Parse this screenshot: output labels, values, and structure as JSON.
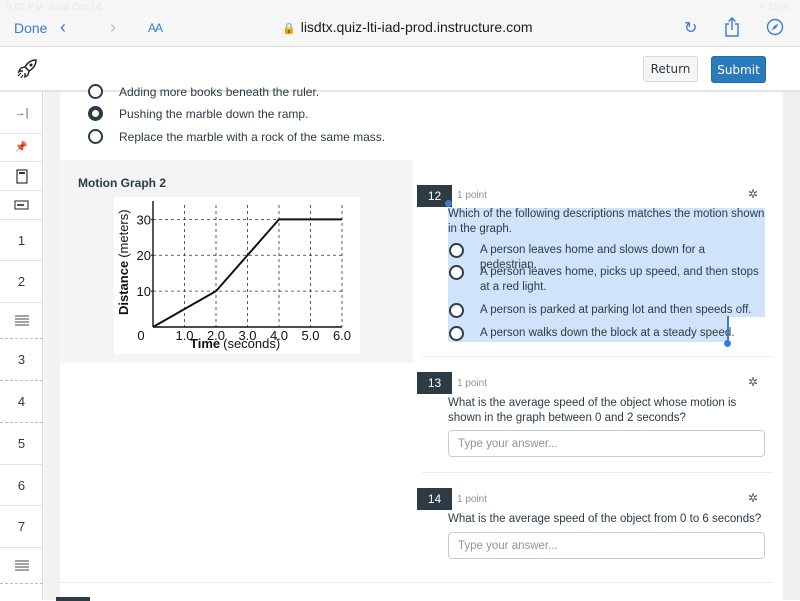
{
  "status_bar": {
    "time": "9:02 PM",
    "date": "Wed Oct 14",
    "battery": "15%"
  },
  "browser": {
    "done_label": "Done",
    "aa_label": "AA",
    "url": "lisdtx.quiz-lti-iad-prod.instructure.com"
  },
  "header": {
    "return_label": "Return",
    "submit_label": "Submit",
    "accent_color": "#2b7abc"
  },
  "rail": {
    "items": [
      {
        "type": "icon",
        "icon": "collapse-icon",
        "glyph": "→|"
      },
      {
        "type": "icon",
        "icon": "pin-icon",
        "glyph": "📌"
      },
      {
        "type": "icon",
        "icon": "page-icon"
      },
      {
        "type": "icon",
        "icon": "stimulus-icon"
      },
      {
        "type": "number",
        "label": "1"
      },
      {
        "type": "number",
        "label": "2"
      },
      {
        "type": "icon",
        "icon": "lines-icon"
      },
      {
        "type": "number",
        "label": "3"
      },
      {
        "type": "number",
        "label": "4"
      },
      {
        "type": "number",
        "label": "5"
      },
      {
        "type": "number",
        "label": "6"
      },
      {
        "type": "number",
        "label": "7"
      },
      {
        "type": "icon",
        "icon": "lines-icon"
      }
    ]
  },
  "previous_question": {
    "options": [
      {
        "label": "Adding more books beneath the ruler.",
        "selected": false
      },
      {
        "label": "Pushing the marble down the ramp.",
        "selected": true
      },
      {
        "label": "Replace the marble with a rock of the same mass.",
        "selected": false
      }
    ]
  },
  "stimulus": {
    "title": "Motion Graph 2"
  },
  "chart_data": {
    "type": "line",
    "title": "",
    "xlabel": "Time (seconds)",
    "xlabel_bold": "Time",
    "xlabel_unit": "(seconds)",
    "ylabel": "Distance (meters)",
    "ylabel_bold": "Distance",
    "ylabel_unit": "(meters)",
    "x": [
      0,
      2.0,
      3.0,
      4.0,
      6.0
    ],
    "series": [
      {
        "name": "distance",
        "values": [
          0,
          10,
          20,
          30,
          30
        ]
      }
    ],
    "xlim": [
      0,
      6
    ],
    "ylim": [
      0,
      34
    ],
    "xticks": [
      "0",
      "1.0",
      "2.0",
      "3.0",
      "4.0",
      "5.0",
      "6.0"
    ],
    "yticks": [
      "10",
      "20",
      "30"
    ],
    "grid": true
  },
  "questions": [
    {
      "number": "12",
      "points": "1 point",
      "text": "Which of the following descriptions matches the motion shown in the graph.",
      "options": [
        {
          "label": "A person leaves home and slows down for a pedestrian.",
          "selected": false
        },
        {
          "label": "A person leaves home, picks up speed, and then stops at a red light.",
          "selected": false
        },
        {
          "label": "A person is parked at parking lot and then speeds off.",
          "selected": false
        },
        {
          "label": "A person walks down the block at a steady speed.",
          "selected": false
        }
      ]
    },
    {
      "number": "13",
      "points": "1 point",
      "text": "What is the average speed of the object whose motion is shown in the graph between 0 and 2 seconds?",
      "answer_value": "",
      "placeholder": "Type your answer..."
    },
    {
      "number": "14",
      "points": "1 point",
      "text": "What is the average speed of the object from 0 to 6 seconds?",
      "answer_value": "",
      "placeholder": "Type your answer..."
    }
  ]
}
